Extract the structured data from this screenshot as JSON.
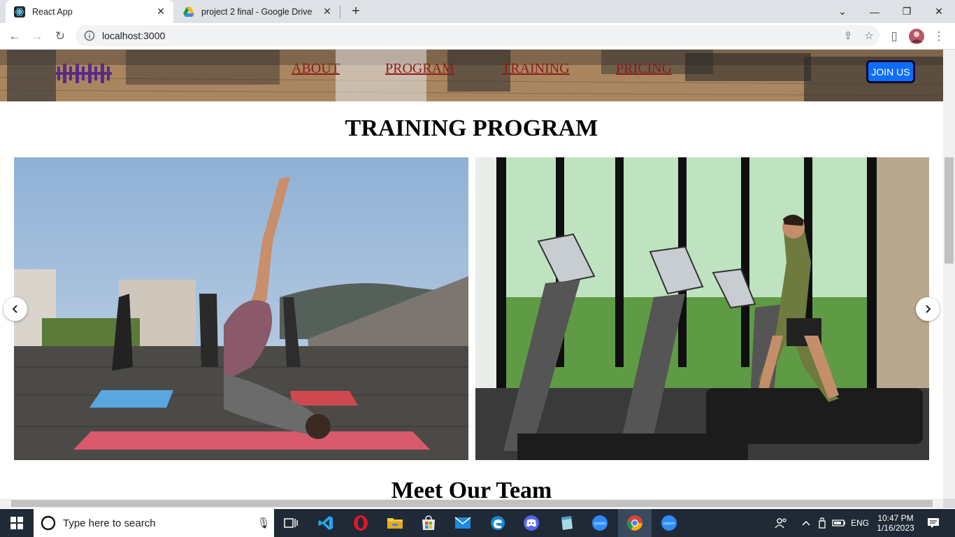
{
  "browser": {
    "tabs": [
      {
        "title": "React App",
        "active": true
      },
      {
        "title": "project 2 final - Google Drive",
        "active": false
      }
    ],
    "new_tab_label": "+",
    "url": "localhost:3000"
  },
  "site": {
    "nav": [
      "ABOUT",
      "PROGRAM",
      "TRAINING",
      "PRICING"
    ],
    "join_label": "JOIN US",
    "section_title": "TRAINING PROGRAM",
    "next_section_title": "Meet Our Team",
    "slides": [
      "yoga-class-photo",
      "treadmill-gym-photo"
    ]
  },
  "taskbar": {
    "search_placeholder": "Type here to search",
    "language": "ENG",
    "time": "10:47 PM",
    "date": "1/16/2023",
    "apps": [
      "task-view",
      "vscode",
      "opera",
      "file-explorer",
      "microsoft-store",
      "mail",
      "edge",
      "discord",
      "notepad",
      "zoom",
      "chrome",
      "zoom"
    ]
  },
  "colors": {
    "tab_strip": "#dee1e6",
    "nav_link": "#8b1d1d",
    "join_button": "#0d6efd",
    "logo": "#5b2a86",
    "taskbar": "#202a36"
  }
}
